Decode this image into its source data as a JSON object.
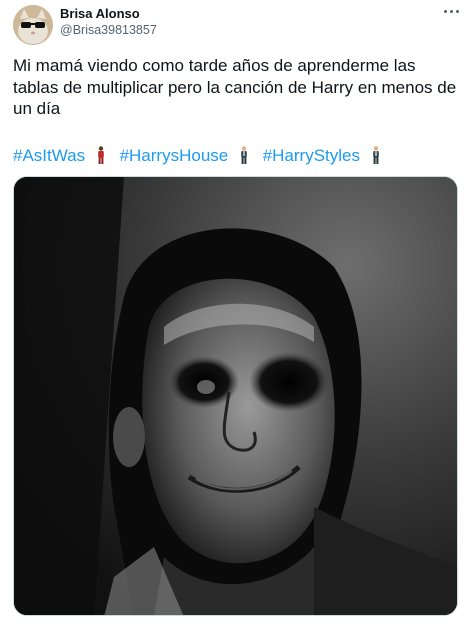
{
  "tweet": {
    "author": {
      "display_name": "Brisa Alonso",
      "handle": "@Brisa39813857",
      "avatar_icon": "avatar-cat-sunglasses-icon"
    },
    "more_icon": "more-horizontal-icon",
    "text": "Mi mamá viendo como tarde años de aprenderme las tablas de multiplicar pero la canción de Harry en menos de un día",
    "hashtags": [
      {
        "label": "#AsItWas",
        "emoji": "man-in-red-suit-emoji"
      },
      {
        "label": "#HarrysHouse",
        "emoji": "man-in-suit-emoji"
      },
      {
        "label": "#HarryStyles",
        "emoji": "man-in-suit-emoji"
      }
    ],
    "media": {
      "description_icon": "uncanny-mr-incredible-meme-image"
    }
  },
  "colors": {
    "text_primary": "#0f1419",
    "text_secondary": "#536471",
    "link": "#1d9bf0",
    "border": "#cfd9de"
  }
}
